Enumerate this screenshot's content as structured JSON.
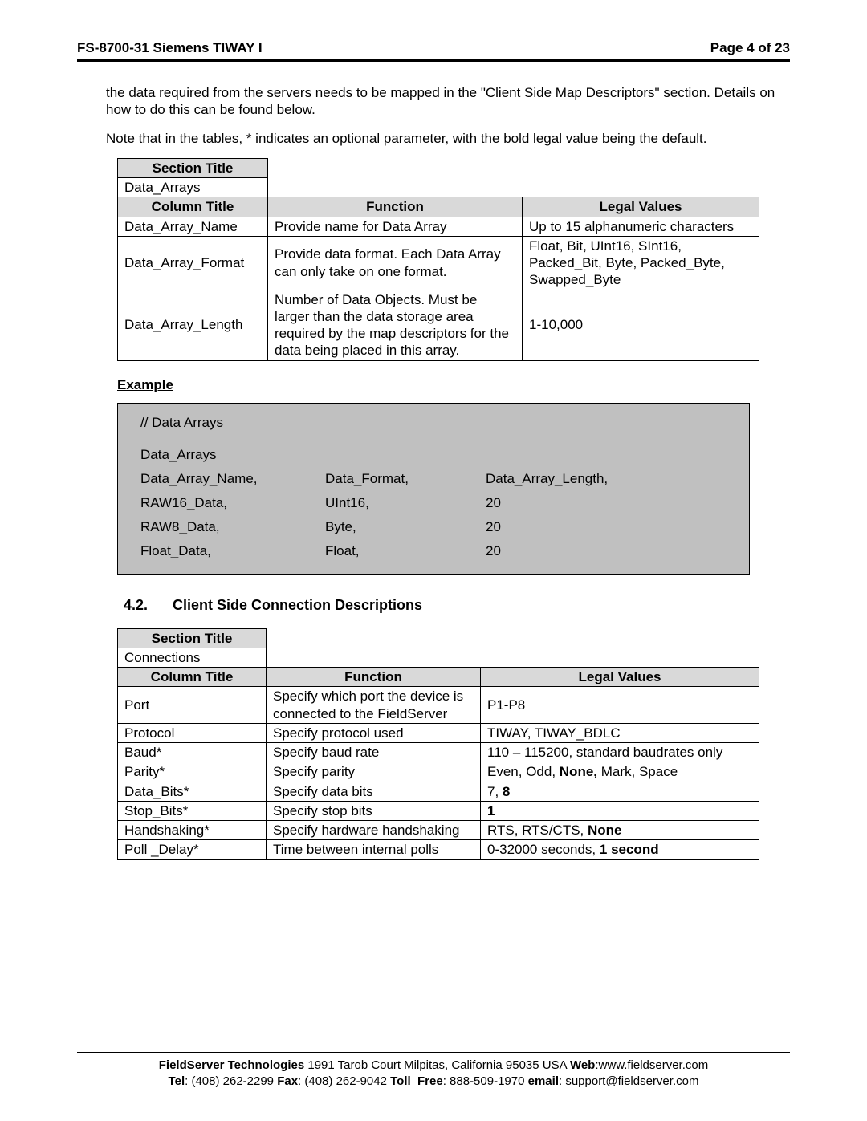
{
  "header": {
    "left": "FS-8700-31 Siemens TIWAY I",
    "right": "Page 4 of 23"
  },
  "intro": {
    "p1": "the data required from the servers needs to be mapped in the \"Client Side Map Descriptors\" section. Details on how to do this can be found below.",
    "p2": "Note that in the tables,  * indicates an optional parameter, with the bold legal value being the default."
  },
  "table1": {
    "sectionTitleLabel": "Section Title",
    "sectionTitleValue": "Data_Arrays",
    "columnTitleLabel": "Column Title",
    "functionLabel": "Function",
    "legalValuesLabel": "Legal Values",
    "rows": [
      {
        "col": "Data_Array_Name",
        "fn": "Provide name for Data Array",
        "lv": "Up to 15 alphanumeric characters"
      },
      {
        "col": "Data_Array_Format",
        "fn": "Provide data format. Each Data Array can only take on one format.",
        "lv": "Float, Bit, UInt16, SInt16, Packed_Bit, Byte, Packed_Byte, Swapped_Byte"
      },
      {
        "col": "Data_Array_Length",
        "fn": "Number of Data Objects. Must be larger than the data storage area required by the map descriptors for the data being placed in this array.",
        "lv": "1-10,000"
      }
    ]
  },
  "exampleLabel": "Example",
  "code": {
    "comment": "//    Data Arrays",
    "l2": "Data_Arrays",
    "header": {
      "c1": "Data_Array_Name,",
      "c2": "Data_Format,",
      "c3": "Data_Array_Length,"
    },
    "rows": [
      {
        "c1": "RAW16_Data,",
        "c2": "UInt16,",
        "c3": "20"
      },
      {
        "c1": "RAW8_Data,",
        "c2": "Byte,",
        "c3": "20"
      },
      {
        "c1": "Float_Data,",
        "c2": "Float,",
        "c3": "20"
      }
    ]
  },
  "sec42": {
    "num": "4.2.",
    "title": "Client Side Connection Descriptions"
  },
  "table2": {
    "sectionTitleLabel": "Section Title",
    "sectionTitleValue": "Connections",
    "columnTitleLabel": "Column Title",
    "functionLabel": "Function",
    "legalValuesLabel": "Legal Values",
    "rows": [
      {
        "col": "Port",
        "fn": "Specify which port the device is connected to the FieldServer",
        "lv": "P1-P8"
      },
      {
        "col": "Protocol",
        "fn": "Specify protocol used",
        "lv": "TIWAY, TIWAY_BDLC"
      },
      {
        "col": "Baud*",
        "fn": "Specify baud rate",
        "lv": "110 – 115200, standard baudrates only"
      },
      {
        "col": "Parity*",
        "fn": "Specify parity",
        "lv": "Even, Odd, <b>None,</b> Mark, Space"
      },
      {
        "col": "Data_Bits*",
        "fn": "Specify data bits",
        "lv": "7, <b>8</b>"
      },
      {
        "col": "Stop_Bits*",
        "fn": "Specify stop bits",
        "lv": "<b>1</b>"
      },
      {
        "col": "Handshaking*",
        "fn": "Specify hardware handshaking",
        "lv": "RTS, RTS/CTS, <b>None</b>"
      },
      {
        "col": "Poll _Delay*",
        "fn": "Time between internal polls",
        "lv": "0-32000 seconds, <b>1 second</b>"
      }
    ]
  },
  "footer": {
    "l1a": "FieldServer Technologies",
    "l1b": " 1991 Tarob Court Milpitas, California 95035 USA  ",
    "l1c": "Web",
    "l1d": ":www.fieldserver.com",
    "l2a": "Tel",
    "l2b": ": (408) 262-2299   ",
    "l2c": "Fax",
    "l2d": ": (408) 262-9042   ",
    "l2e": "Toll_Free",
    "l2f": ": 888-509-1970   ",
    "l2g": "email",
    "l2h": ": support@fieldserver.com"
  }
}
